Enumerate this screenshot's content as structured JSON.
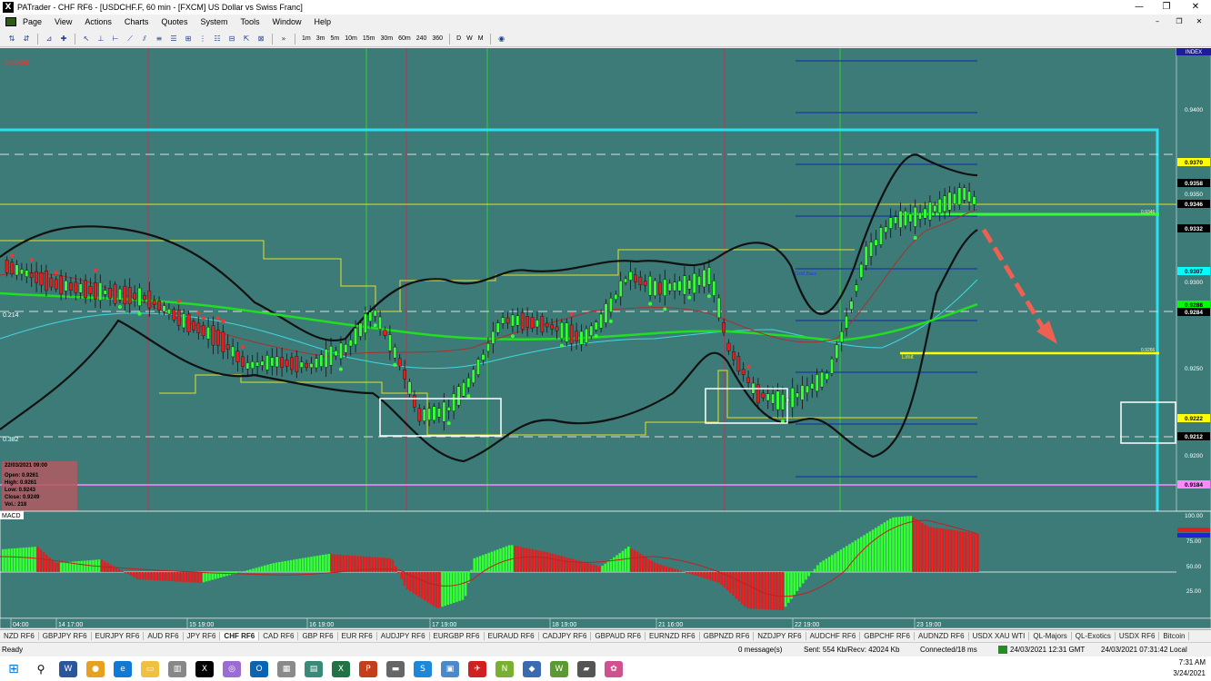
{
  "window": {
    "title": "PATrader - CHF RF6 - [USDCHF.F, 60 min - [FXCM] US Dollar vs Swiss Franc]",
    "min": "—",
    "max": "❐",
    "close": "✕"
  },
  "menu": [
    "Page",
    "View",
    "Actions",
    "Charts",
    "Quotes",
    "System",
    "Tools",
    "Window",
    "Help"
  ],
  "mdi": {
    "min": "–",
    "restore": "❐",
    "close": "✕"
  },
  "toolbar": {
    "timeframes": [
      "1m",
      "3m",
      "5m",
      "10m",
      "15m",
      "30m",
      "60m",
      "240",
      "360"
    ],
    "periods": [
      "D",
      "W",
      "M"
    ],
    "more": "»"
  },
  "chart": {
    "locked": "Locked",
    "index_label": "INDEX",
    "macd_label": "MACD",
    "price_axis": [
      "0.9400",
      "0.9350",
      "0.9300",
      "0.9250",
      "0.9200"
    ],
    "price_tags": [
      {
        "text": "0.9370",
        "color": "#ffff00"
      },
      {
        "text": "0.9358",
        "color": "#000000"
      },
      {
        "text": "0.9346",
        "color": "#000000"
      },
      {
        "text": "0.9332",
        "color": "#000000"
      },
      {
        "text": "0.9307",
        "color": "#00ffff"
      },
      {
        "text": "0.9288",
        "color": "#00ff00"
      },
      {
        "text": "0.9284",
        "color": "#000000"
      },
      {
        "text": "0.9222",
        "color": "#ffff00"
      },
      {
        "text": "0.9212",
        "color": "#000000"
      },
      {
        "text": "0.9184",
        "color": "#ff88ff"
      }
    ],
    "fib_left": [
      "0.214",
      "0.382"
    ],
    "line_labels": {
      "grid_base": "Grid Base",
      "limit": "Limit",
      "mid": "0.9346",
      "limit_val": "0.9266"
    },
    "ohlc": {
      "date": "22/03/2021 09:00",
      "open": "Open: 0.9261",
      "high": "High: 0.9261",
      "low": "Low: 0.9243",
      "close": "Close: 0.9249",
      "vol": "Vol.: 218"
    },
    "macd_axis": [
      "100.00",
      "75.00",
      "50.00",
      "25.00"
    ],
    "time_axis": [
      "04:00",
      "14 17:00",
      "15 19:00",
      "16 19:00",
      "17 19:00",
      "18 19:00",
      "21 16:00",
      "22 19:00",
      "23 19:00"
    ]
  },
  "tabs": [
    "NZD RF6",
    "GBPJPY RF6",
    "EURJPY RF6",
    "AUD RF6",
    "JPY RF6",
    "CHF RF6",
    "CAD RF6",
    "GBP RF6",
    "EUR RF6",
    "AUDJPY RF6",
    "EURGBP RF6",
    "EURAUD RF6",
    "CADJPY RF6",
    "GBPAUD RF6",
    "EURNZD RF6",
    "GBPNZD RF6",
    "NZDJPY RF6",
    "AUDCHF RF6",
    "GBPCHF RF6",
    "AUDNZD RF6",
    "USDX XAU WTI",
    "QL-Majors",
    "QL-Exotics",
    "USDX RF6",
    "Bitcoin"
  ],
  "active_tab": "CHF RF6",
  "status": {
    "ready": "Ready",
    "messages": "0 message(s)",
    "traffic": "Sent: 554 Kb/Recv: 42024 Kb",
    "connected": "Connected/18 ms",
    "gmt": "24/03/2021 12:31 GMT",
    "local": "24/03/2021 07:31:42 Local"
  },
  "clock": {
    "time": "7:31 AM",
    "date": "3/24/2021"
  }
}
